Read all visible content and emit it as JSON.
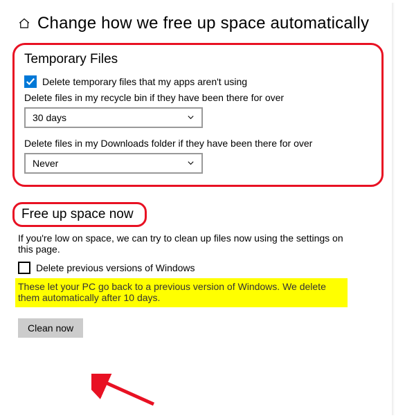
{
  "header": {
    "title": "Change how we free up space automatically"
  },
  "temporaryFiles": {
    "heading": "Temporary Files",
    "deleteTempLabel": "Delete temporary files that my apps aren't using",
    "recycleBinLabel": "Delete files in my recycle bin if they have been there for over",
    "recycleBinValue": "30 days",
    "downloadsLabel": "Delete files in my Downloads folder if they have been there for over",
    "downloadsValue": "Never"
  },
  "freeUpNow": {
    "heading": "Free up space now",
    "description": "If you're low on space, we can try to clean up files now using the settings on this page.",
    "deletePreviousLabel": "Delete previous versions of Windows",
    "previousNote": "These let your PC go back to a previous version of Windows. We delete them automatically after 10 days.",
    "cleanButton": "Clean now"
  }
}
